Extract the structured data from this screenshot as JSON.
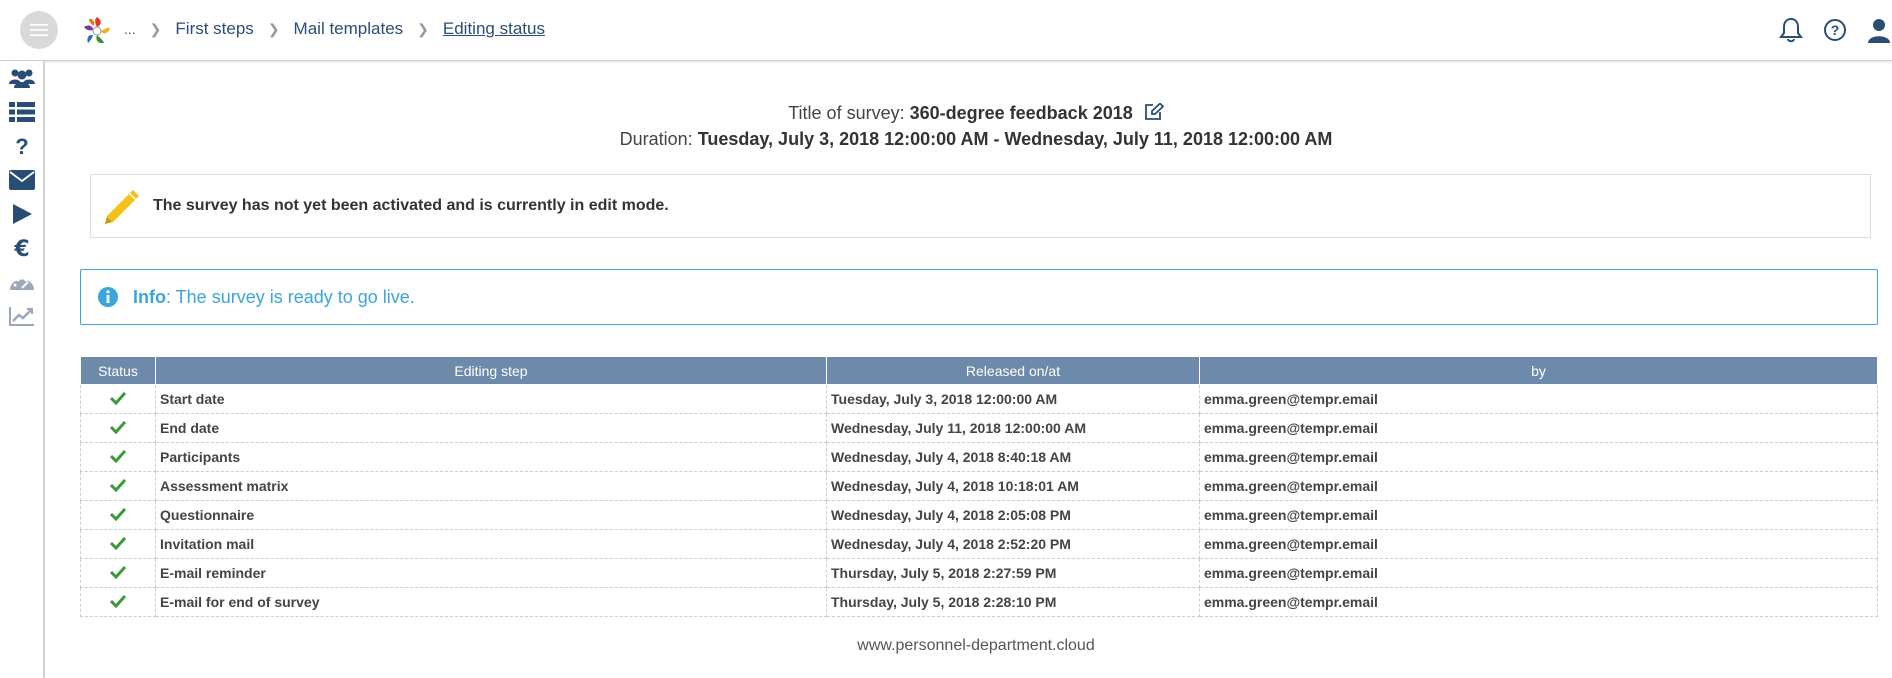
{
  "header": {
    "breadcrumb": {
      "ellipsis": "...",
      "items": [
        "First steps",
        "Mail templates",
        "Editing status"
      ]
    }
  },
  "icons": {
    "menu": "hamburger-menu-icon",
    "logo": "company-logo",
    "notifications": "bell-icon",
    "help": "help-circle-icon",
    "user": "user-icon",
    "sidebar": [
      "users-group-icon",
      "list-icon",
      "question-icon",
      "envelope-icon",
      "play-icon",
      "euro-icon",
      "dashboard-icon",
      "chart-line-icon"
    ]
  },
  "survey": {
    "title_label": "Title of survey:",
    "title": "360-degree feedback 2018",
    "duration_label": "Duration:",
    "duration": "Tuesday, July 3, 2018 12:00:00 AM - Wednesday, July 11, 2018 12:00:00 AM"
  },
  "notice": {
    "text": "The survey has not yet been activated and is currently in edit mode."
  },
  "info": {
    "label": "Info",
    "text": ": The survey is ready to go live."
  },
  "table": {
    "columns": [
      "Status",
      "Editing step",
      "Released on/at",
      "by"
    ],
    "rows": [
      {
        "step": "Start date",
        "released": "Tuesday, July 3, 2018 12:00:00 AM",
        "by": "emma.green@tempr.email"
      },
      {
        "step": "End date",
        "released": "Wednesday, July 11, 2018 12:00:00 AM",
        "by": "emma.green@tempr.email"
      },
      {
        "step": "Participants",
        "released": "Wednesday, July 4, 2018 8:40:18 AM",
        "by": "emma.green@tempr.email"
      },
      {
        "step": "Assessment matrix",
        "released": "Wednesday, July 4, 2018 10:18:01 AM",
        "by": "emma.green@tempr.email"
      },
      {
        "step": "Questionnaire",
        "released": "Wednesday, July 4, 2018 2:05:08 PM",
        "by": "emma.green@tempr.email"
      },
      {
        "step": "Invitation mail",
        "released": "Wednesday, July 4, 2018 2:52:20 PM",
        "by": "emma.green@tempr.email"
      },
      {
        "step": "E-mail reminder",
        "released": "Thursday, July 5, 2018 2:27:59 PM",
        "by": "emma.green@tempr.email"
      },
      {
        "step": "E-mail for end of survey",
        "released": "Thursday, July 5, 2018 2:28:10 PM",
        "by": "emma.green@tempr.email"
      }
    ]
  },
  "footer": {
    "text": "www.personnel-department.cloud"
  },
  "colors": {
    "accent": "#3aa6d8",
    "table_header": "#6d8aaa",
    "check": "#3a9a3a",
    "pencil": "#f2c21a",
    "nav_text": "#2a4e73"
  }
}
